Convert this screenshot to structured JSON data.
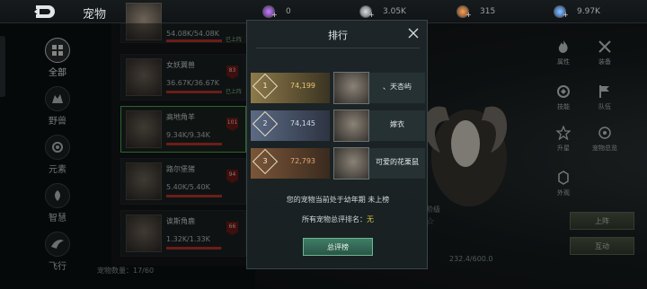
{
  "topbar": {
    "title": "宠物",
    "currencies": [
      {
        "icon": "purple-gem-icon",
        "value": "0",
        "color": "#9b5cc9"
      },
      {
        "icon": "silver-coin-icon",
        "value": "3.05K",
        "color": "#9aa0a3"
      },
      {
        "icon": "copper-coin-icon",
        "value": "315",
        "color": "#c7753b"
      },
      {
        "icon": "blue-crystal-icon",
        "value": "9.97K",
        "color": "#4b86d6"
      }
    ]
  },
  "categories": [
    {
      "label": "全部",
      "icon": "grid-icon",
      "active": true
    },
    {
      "label": "野兽",
      "icon": "beast-icon",
      "active": false
    },
    {
      "label": "元素",
      "icon": "element-icon",
      "active": false
    },
    {
      "label": "智慧",
      "icon": "wisdom-icon",
      "active": false
    },
    {
      "label": "飞行",
      "icon": "wing-icon",
      "active": false
    }
  ],
  "pets": [
    {
      "name": "",
      "hp": "54.08K/54.08K",
      "hp_fraction": 1.0,
      "level": "",
      "tag": "已上阵"
    },
    {
      "name": "女妖翼兽",
      "hp": "36.67K/36.67K",
      "hp_fraction": 1.0,
      "level": "83",
      "tag": "已上阵"
    },
    {
      "name": "高地角羊",
      "hp": "9.34K/9.34K",
      "hp_fraction": 1.0,
      "level": "101",
      "tag": ""
    },
    {
      "name": "路尔堡猪",
      "hp": "5.40K/5.40K",
      "hp_fraction": 1.0,
      "level": "94",
      "tag": ""
    },
    {
      "name": "诶斯角鹿",
      "hp": "1.32K/1.33K",
      "hp_fraction": 0.99,
      "level": "66",
      "tag": ""
    }
  ],
  "pet_count_label": "宠物数量：17/60",
  "detail": {
    "level_label": "阶级",
    "xp": "232.4/600.0",
    "side_buttons": [
      {
        "label": "属性",
        "icon": "fire-icon"
      },
      {
        "label": "装备",
        "icon": "crossed-swords-icon"
      },
      {
        "label": "技能",
        "icon": "skill-icon"
      },
      {
        "label": "队伍",
        "icon": "flag-icon"
      },
      {
        "label": "升星",
        "icon": "star-icon"
      },
      {
        "label": "宠物总览",
        "icon": "overview-icon"
      },
      {
        "label": "外观",
        "icon": "appearance-icon"
      }
    ],
    "deploy_button": "上阵",
    "interact_button": "互动"
  },
  "dialog": {
    "title": "排行",
    "rows": [
      {
        "rank": "1",
        "score": "74,199",
        "name": "、天杏屿",
        "accent": "#8e7a4a",
        "score_color": "#e7c66f"
      },
      {
        "rank": "2",
        "score": "74,145",
        "name": "嫁衣",
        "accent": "#5c6a84",
        "score_color": "#cdd8f0"
      },
      {
        "rank": "3",
        "score": "72,793",
        "name": "可爱的花栗鼠",
        "accent": "#7b5638",
        "score_color": "#e2a874"
      }
    ],
    "status_text": "您的宠物当前处于幼年期  未上榜",
    "total_rank_label": "所有宠物总评排名：",
    "total_rank_value": "无",
    "total_button": "总评榜"
  }
}
